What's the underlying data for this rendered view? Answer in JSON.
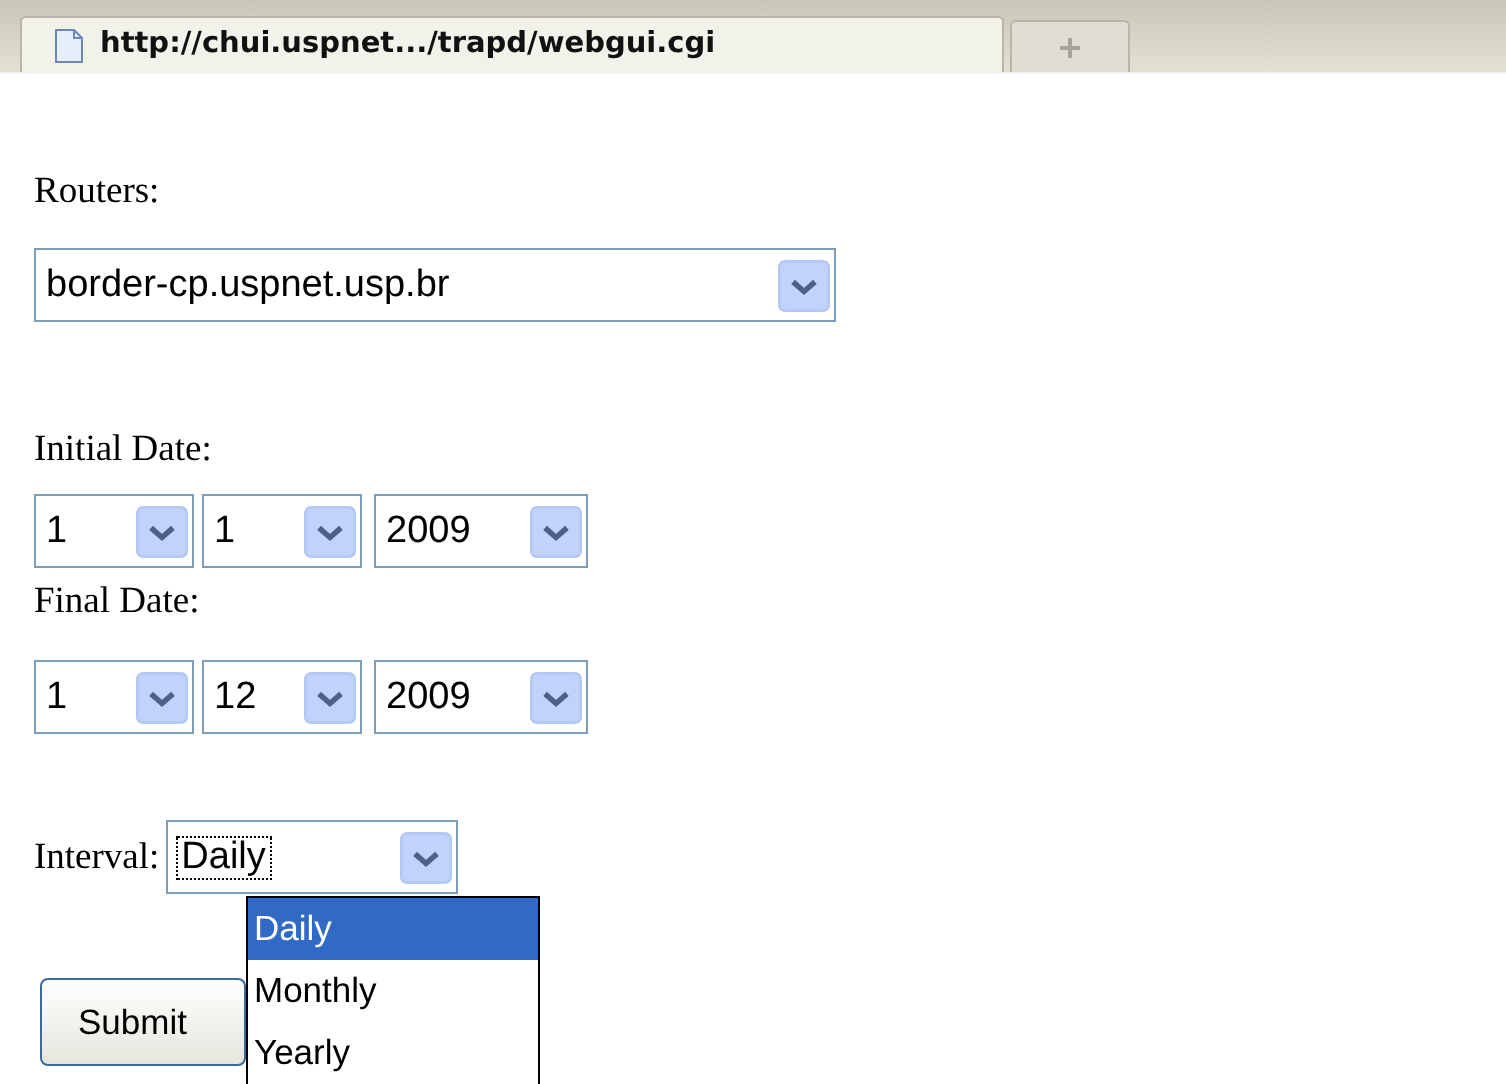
{
  "browser_tab": {
    "title": "http://chui.uspnet.../trapd/webgui.cgi"
  },
  "routers": {
    "label": "Routers:",
    "value": "border-cp.uspnet.usp.br"
  },
  "initial_date": {
    "label": "Initial Date:",
    "selects": [
      {
        "value": "1"
      },
      {
        "value": "1"
      },
      {
        "value": "2009"
      }
    ]
  },
  "final_date": {
    "label": "Final Date:",
    "selects": [
      {
        "value": "1"
      },
      {
        "value": "12"
      },
      {
        "value": "2009"
      }
    ]
  },
  "interval": {
    "label": "Interval:",
    "value": "Daily",
    "expanded": true,
    "options": [
      {
        "label": "Daily",
        "selected": true
      },
      {
        "label": "Monthly",
        "selected": false
      },
      {
        "label": "Yearly",
        "selected": false
      }
    ]
  },
  "submit": "Submit"
}
